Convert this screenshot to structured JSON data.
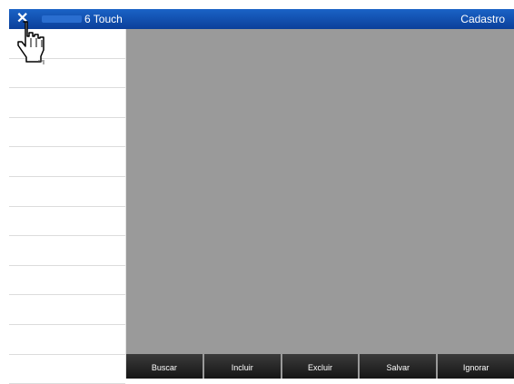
{
  "header": {
    "close_icon": "close-icon",
    "app_title": "6 Touch",
    "screen_title": "Cadastro"
  },
  "sidebar": {
    "rows": 12
  },
  "toolbar": {
    "buttons": [
      "Buscar",
      "Incluir",
      "Excluir",
      "Salvar",
      "Ignorar"
    ]
  },
  "colors": {
    "header_top": "#1a63c6",
    "header_bottom": "#0b3f9a",
    "content_bg": "#9a9a9a",
    "button_bg": "#1f1f1f"
  },
  "pointer": "hand-pointer-icon"
}
